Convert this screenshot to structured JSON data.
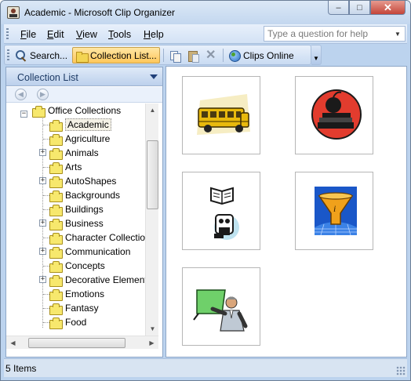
{
  "window": {
    "title": "Academic - Microsoft Clip Organizer"
  },
  "window_buttons": {
    "minimize": "–",
    "maximize": "□",
    "close": "✕"
  },
  "menu": {
    "items": [
      {
        "key": "F",
        "rest": "ile"
      },
      {
        "key": "E",
        "rest": "dit"
      },
      {
        "key": "V",
        "rest": "iew"
      },
      {
        "key": "T",
        "rest": "ools"
      },
      {
        "key": "H",
        "rest": "elp"
      }
    ],
    "help_placeholder": "Type a question for help"
  },
  "toolbar": {
    "search_label": "Search...",
    "collection_list_label": "Collection List...",
    "clips_online_label": "Clips Online",
    "icons": [
      "search-icon",
      "folder-icon",
      "copy-icon",
      "paste-icon",
      "delete-icon",
      "globe-icon"
    ]
  },
  "left_pane": {
    "header": "Collection List",
    "nav": {
      "back": "◀",
      "forward": "▶"
    },
    "root": "Office Collections",
    "items": [
      {
        "label": "Academic",
        "expandable": false,
        "selected": true
      },
      {
        "label": "Agriculture",
        "expandable": false
      },
      {
        "label": "Animals",
        "expandable": true
      },
      {
        "label": "Arts",
        "expandable": false
      },
      {
        "label": "AutoShapes",
        "expandable": true
      },
      {
        "label": "Backgrounds",
        "expandable": false
      },
      {
        "label": "Buildings",
        "expandable": false
      },
      {
        "label": "Business",
        "expandable": true
      },
      {
        "label": "Character Collectio",
        "expandable": false
      },
      {
        "label": "Communication",
        "expandable": true
      },
      {
        "label": "Concepts",
        "expandable": false
      },
      {
        "label": "Decorative Element",
        "expandable": true
      },
      {
        "label": "Emotions",
        "expandable": false
      },
      {
        "label": "Fantasy",
        "expandable": false
      },
      {
        "label": "Food",
        "expandable": false
      }
    ]
  },
  "clips": [
    {
      "name": "school-bus-clip"
    },
    {
      "name": "apple-books-clip"
    },
    {
      "name": "reading-student-clip"
    },
    {
      "name": "info-funnel-clip"
    },
    {
      "name": "teacher-chalkboard-clip"
    }
  ],
  "status": {
    "text": "5 Items"
  }
}
